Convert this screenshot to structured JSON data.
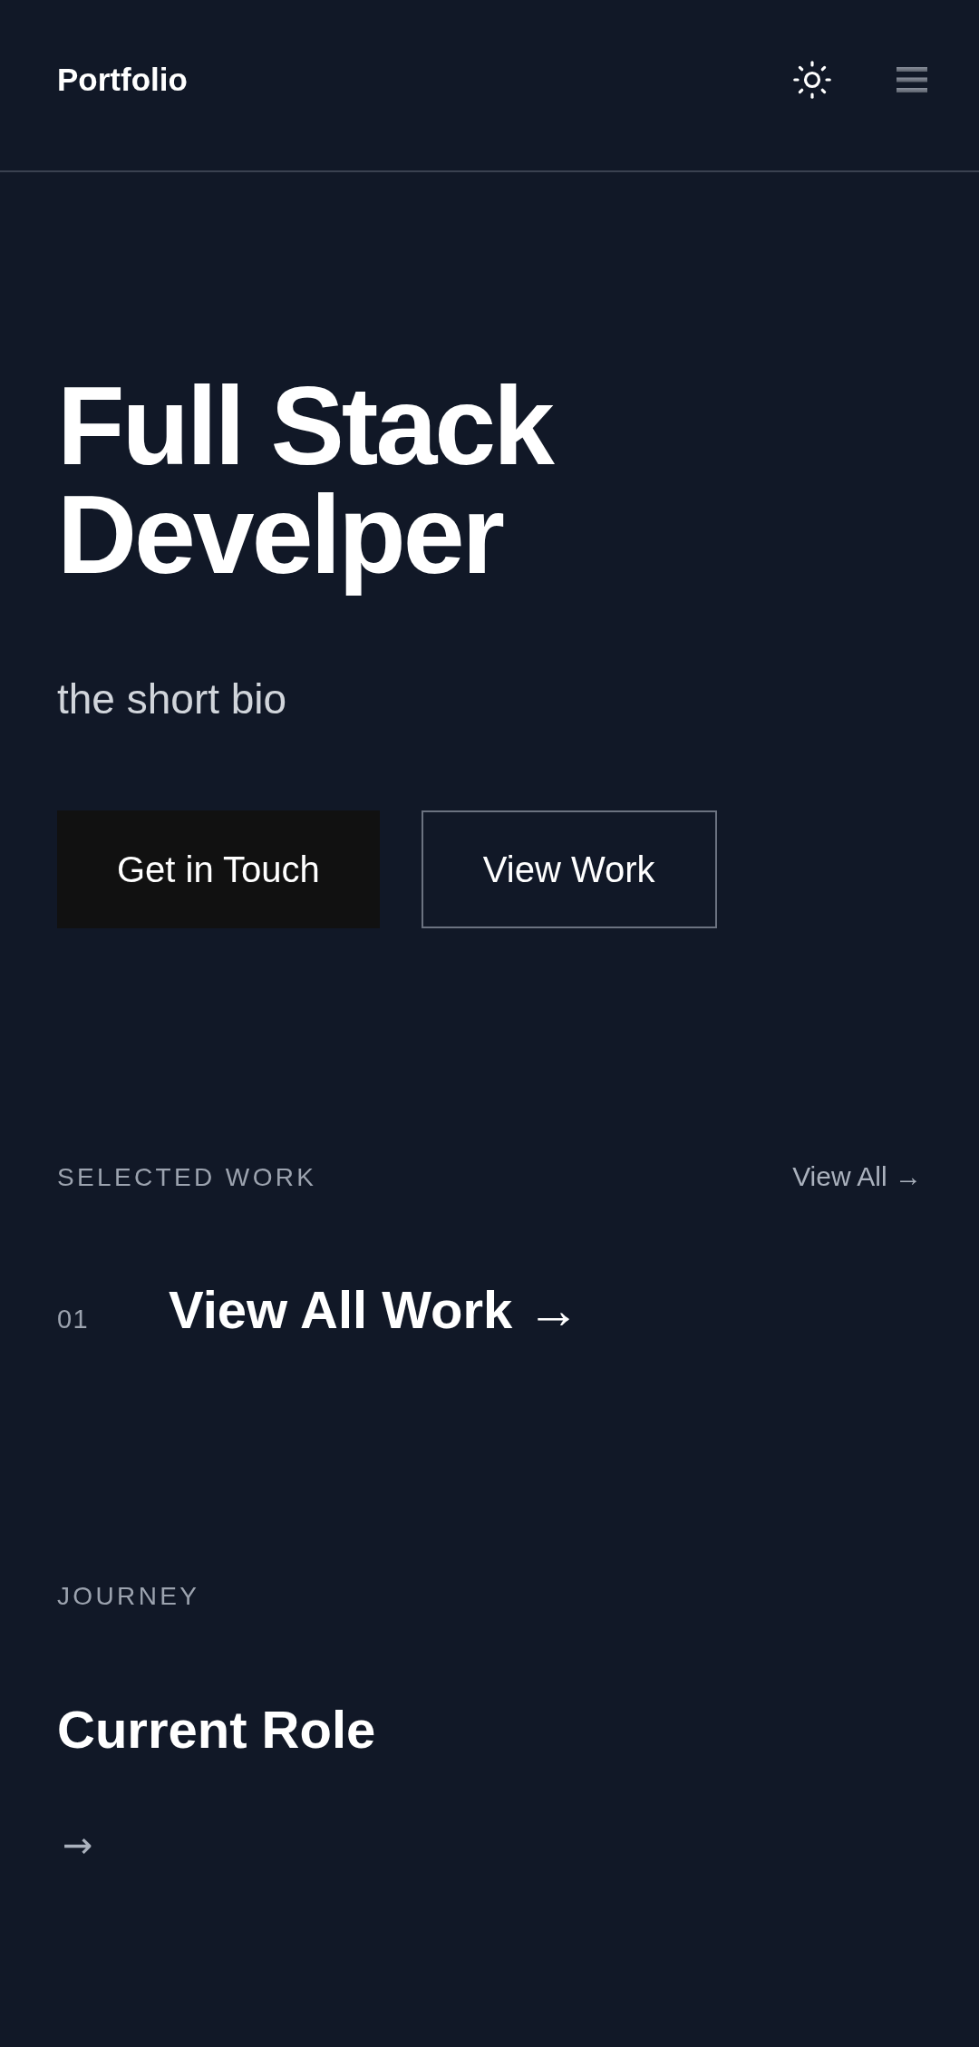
{
  "header": {
    "brand": "Portfolio"
  },
  "hero": {
    "title": "Full Stack Develper",
    "bio": "the short bio",
    "buttons": [
      {
        "label": "Get in Touch",
        "kind": "primary"
      },
      {
        "label": "View Work",
        "kind": "outline"
      }
    ]
  },
  "selected_work": {
    "heading": "SELECTED WORK",
    "view_all": "View All →",
    "projects": [
      {
        "number": "01",
        "title": "View All Work →"
      }
    ]
  },
  "journey": {
    "heading": "JOURNEY",
    "items": [
      {
        "title": "Current Role",
        "link": "→"
      }
    ]
  }
}
